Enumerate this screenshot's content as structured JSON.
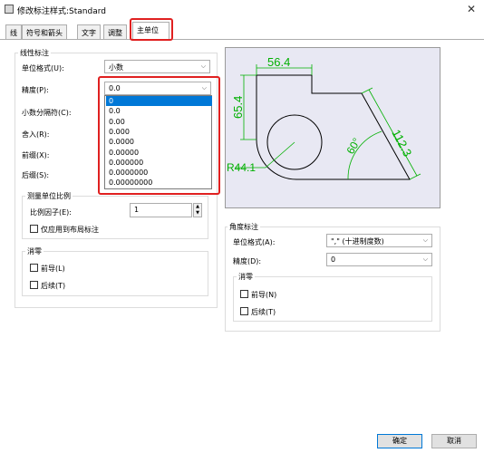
{
  "window": {
    "title": "修改标注样式:Standard",
    "close_glyph": "✕"
  },
  "tabs": [
    {
      "label": "线"
    },
    {
      "label": "符号和箭头"
    },
    {
      "label": "文字"
    },
    {
      "label": "调整"
    },
    {
      "label": "主单位"
    }
  ],
  "linear": {
    "group_title": "线性标注",
    "unit_format_label": "单位格式(U):",
    "unit_format_value": "小数",
    "precision_label": "精度(P):",
    "precision_value": "0.0",
    "decimal_sep_label": "小数分隔符(C):",
    "round_label": "舍入(R):",
    "prefix_label": "前缀(X):",
    "suffix_label": "后缀(S):",
    "precision_options": [
      "0",
      "0.0",
      "0.00",
      "0.000",
      "0.0000",
      "0.00000",
      "0.000000",
      "0.0000000",
      "0.00000000"
    ],
    "selected_option_index": 0
  },
  "scale": {
    "group_title": "测量单位比例",
    "factor_label": "比例因子(E):",
    "factor_value": "1",
    "layout_label": "仅应用到布局标注"
  },
  "zero_linear": {
    "group_title": "消零",
    "leading_label": "前导(L)",
    "trailing_label": "后续(T)"
  },
  "preview": {
    "dim_top": "56.4",
    "dim_left": "65.4",
    "dim_slant": "112.3",
    "dim_radius": "R44.1",
    "dim_angle": "60°"
  },
  "angular": {
    "group_title": "角度标注",
    "unit_format_label": "单位格式(A):",
    "unit_format_value": "\",\" (十进制度数)",
    "precision_label": "精度(D):",
    "precision_value": "0",
    "zero_title": "消零",
    "leading_label": "前导(N)",
    "trailing_label": "后续(T)"
  },
  "buttons": {
    "ok": "确定",
    "cancel": "取消"
  },
  "colors": {
    "highlight": "#e02020",
    "dim_green": "#00b000",
    "selection": "#0078d7"
  }
}
